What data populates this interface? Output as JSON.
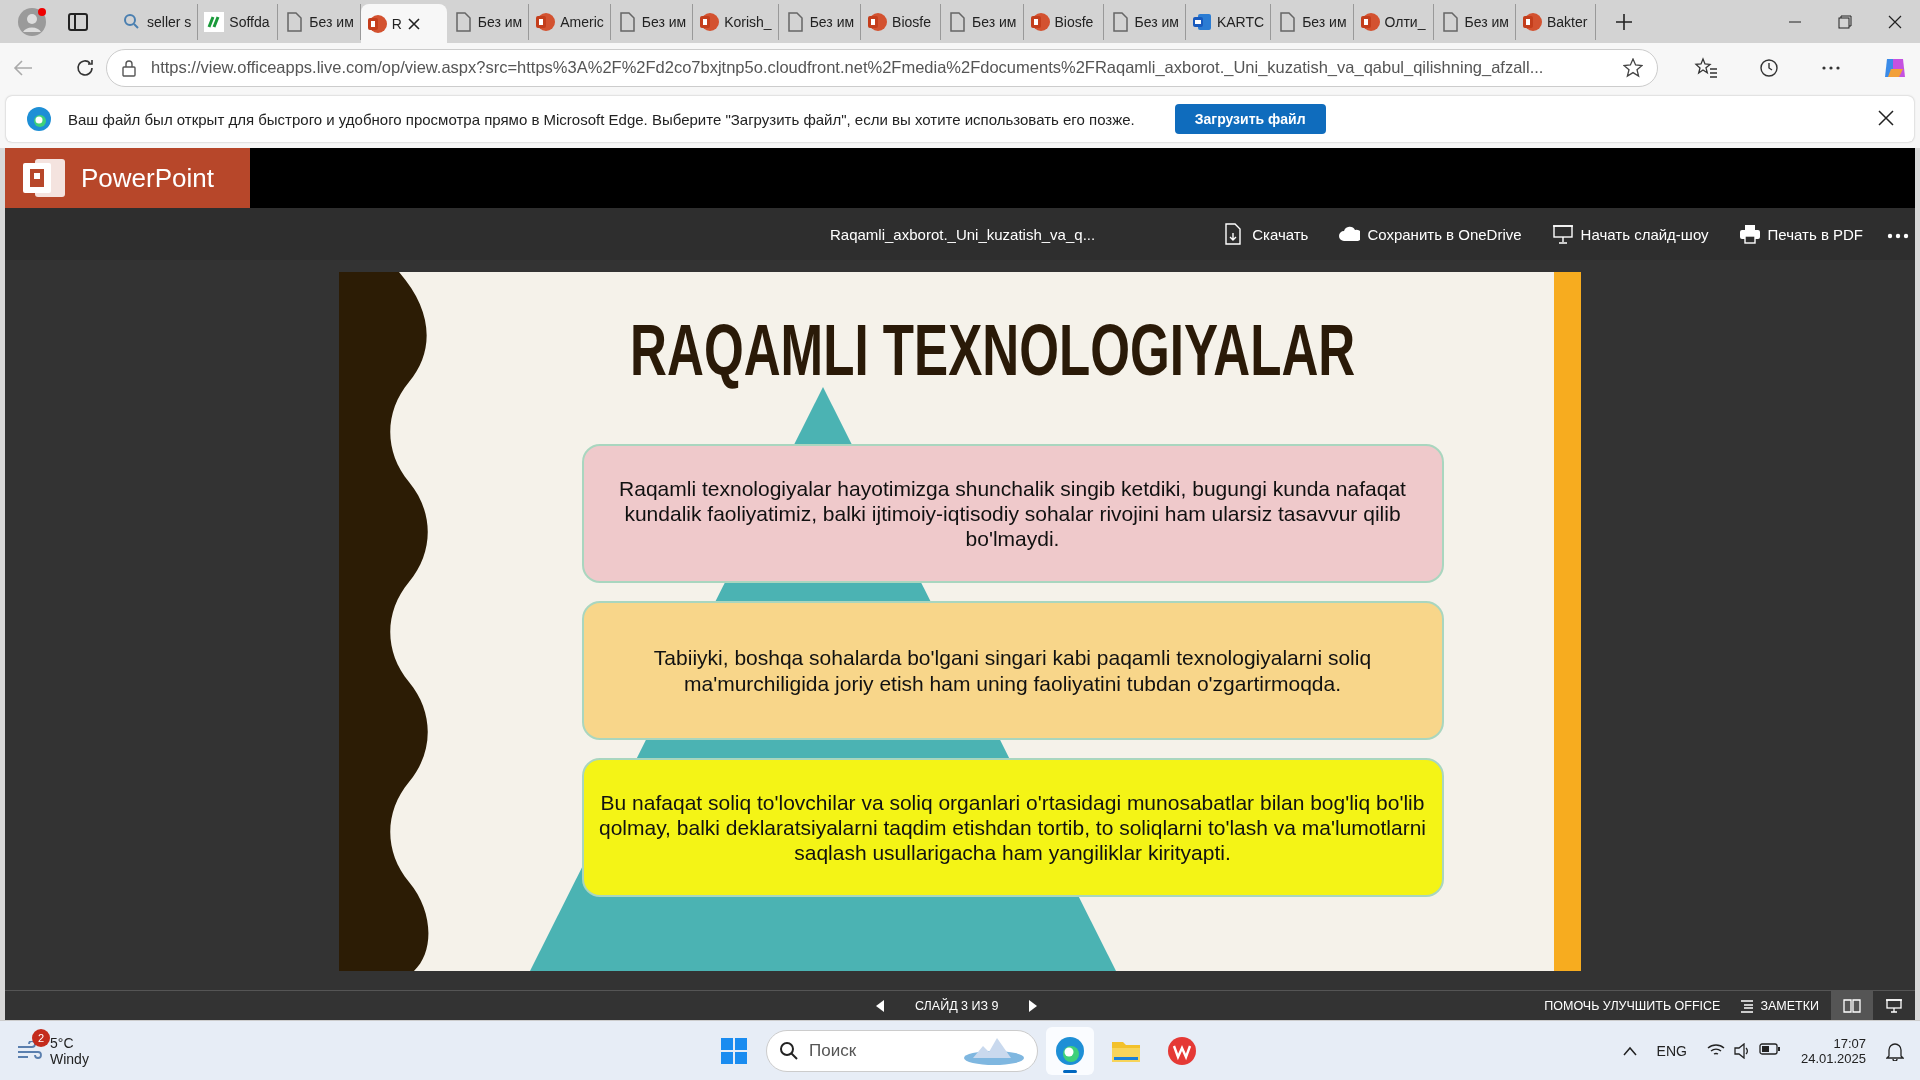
{
  "browser": {
    "tabs": [
      {
        "kind": "search",
        "label": "seller s",
        "selected": false
      },
      {
        "kind": "site",
        "label": "Soffda",
        "selected": false
      },
      {
        "kind": "doc",
        "label": "Без им",
        "selected": false
      },
      {
        "kind": "ppt",
        "label": "R",
        "selected": true
      },
      {
        "kind": "doc",
        "label": "Без им",
        "selected": false
      },
      {
        "kind": "ppt",
        "label": "Americ",
        "selected": false
      },
      {
        "kind": "doc",
        "label": "Без им",
        "selected": false
      },
      {
        "kind": "ppt",
        "label": "Korish_",
        "selected": false
      },
      {
        "kind": "doc",
        "label": "Без им",
        "selected": false
      },
      {
        "kind": "ppt",
        "label": "Biosfe",
        "selected": false
      },
      {
        "kind": "doc",
        "label": "Без им",
        "selected": false
      },
      {
        "kind": "ppt",
        "label": "Biosfe",
        "selected": false
      },
      {
        "kind": "doc",
        "label": "Без им",
        "selected": false
      },
      {
        "kind": "word",
        "label": "KARTC",
        "selected": false
      },
      {
        "kind": "doc",
        "label": "Без им",
        "selected": false
      },
      {
        "kind": "ppt",
        "label": "Олти_",
        "selected": false
      },
      {
        "kind": "doc",
        "label": "Без им",
        "selected": false
      },
      {
        "kind": "ppt",
        "label": "Bakter",
        "selected": false
      }
    ],
    "address": "https://view.officeapps.live.com/op/view.aspx?src=https%3A%2F%2Fd2co7bxjtnp5o.cloudfront.net%2Fmedia%2Fdocuments%2FRaqamli_axborot._Uni_kuzatish_va_qabul_qilishning_afzall...",
    "info_bar": {
      "message": "Ваш файл был открыт для быстрого и удобного просмотра прямо в Microsoft Edge. Выберите \"Загрузить файл\", если вы хотите использовать его позже.",
      "button": "Загрузить файл"
    }
  },
  "app": {
    "name": "PowerPoint",
    "document_title": "Raqamli_axborot._Uni_kuzatish_va_q...",
    "actions": [
      {
        "kind": "download",
        "label": "Скачать"
      },
      {
        "kind": "cloud",
        "label": "Сохранить в OneDrive"
      },
      {
        "kind": "slideshow",
        "label": "Начать слайд-шоу"
      },
      {
        "kind": "print",
        "label": "Печать в PDF"
      }
    ],
    "slide": {
      "title": "RAQAMLI TEXNOLOGIYALAR",
      "blocks": [
        {
          "text": "Raqamli texnologiyalar hayotimizga shunchalik singib ketdiki, bugungi kunda nafaqat kundalik faoliyatimiz, balki ijtimoiy-iqtisodiy sohalar rivojini ham ularsiz tasavvur qilib bo'lmaydi.",
          "color": "#efc9cb"
        },
        {
          "text": "Tabiiyki, boshqa sohalarda bo'lgani singari kabi  paqamli texnologiyalarni soliq ma'murchiligida joriy etish ham  uning faoliyatini tubdan o'zgartirmoqda.",
          "color": "#f8d68a"
        },
        {
          "text": "Bu nafaqat soliq to'lovchilar va soliq organlari o'rtasidagi munosabatlar bilan bog'liq bo'lib qolmay, balki deklaratsiyalarni taqdim etishdan tortib, to soliqlarni to'lash va ma'lumotlarni saqlash usullarigacha ham yangiliklar kirityapti.",
          "color": "#f4f416"
        }
      ]
    },
    "status": {
      "slide_counter": "СЛАЙД 3 ИЗ 9",
      "help": "ПОМОЧЬ УЛУЧШИТЬ OFFICE",
      "notes": "ЗАМЕТКИ",
      "views": [
        {
          "kind": "reading",
          "selected": true
        },
        {
          "kind": "slideshow",
          "selected": false
        }
      ]
    }
  },
  "taskbar": {
    "weather": {
      "badge": "2",
      "temperature": "5°C",
      "condition": "Windy"
    },
    "search_placeholder": "Поиск",
    "apps": [
      {
        "kind": "start",
        "selected": false
      },
      {
        "kind": "edge",
        "selected": true
      },
      {
        "kind": "files",
        "selected": false
      },
      {
        "kind": "wps",
        "selected": false
      }
    ],
    "language": "ENG",
    "time": "17:07",
    "date": "24.01.2025"
  }
}
